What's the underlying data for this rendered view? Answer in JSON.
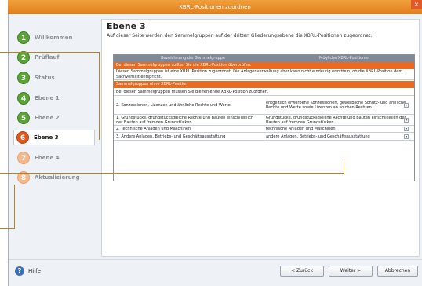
{
  "window": {
    "title": "XBRL-Positionen zuordnen",
    "close_label": "×"
  },
  "sidebar": {
    "items": [
      {
        "num": "1",
        "label": "Willkommen",
        "state": "done"
      },
      {
        "num": "2",
        "label": "Prüflauf",
        "state": "done"
      },
      {
        "num": "3",
        "label": "Status",
        "state": "done"
      },
      {
        "num": "4",
        "label": "Ebene 1",
        "state": "done"
      },
      {
        "num": "5",
        "label": "Ebene 2",
        "state": "done"
      },
      {
        "num": "6",
        "label": "Ebene 3",
        "state": "active"
      },
      {
        "num": "7",
        "label": "Ebene 4",
        "state": "pending"
      },
      {
        "num": "8",
        "label": "Aktualisierung",
        "state": "pending"
      }
    ]
  },
  "main": {
    "title": "Ebene 3",
    "description": "Auf dieser Seite werden den Sammelgruppen auf der dritten Gliederungsebene die XBRL-Positionen zugeordnet."
  },
  "grid": {
    "columns": [
      "Bezeichnung der Sammelgruppe",
      "Mögliche XBRL-Positionen"
    ],
    "section1_header": "Bei diesen Sammelgruppen sollten Sie die XBRL-Position überprüfen.",
    "section1_info": "Diesen Sammelgruppen ist eine XBRL-Position zugeordnet. Die Anlagenverwaltung aber kann nicht eindeutig ermitteln, ob die XBRL-Position dem Sachverhalt entspricht.",
    "section2_header": "Sammelgruppen ohne XBRL-Position",
    "section2_info": "Bei diesen Sammelgruppen müssen Sie die fehlende XBRL-Position zuordnen.",
    "rows": [
      {
        "group": "2. Konzessionen, Lizenzen und ähnliche Rechte und Werte",
        "position": "entgeltlich erworbene Konzessionen, gewerbliche Schutz- und ähnliche Rechte und Werte sowie Lizenzen an solchen Rechten ..."
      },
      {
        "group": "1. Grundstücke, grundstücksgleiche Rechte und Bauten einschließlich der Bauten auf fremden Grundstücken",
        "position": "Grundstücke, grundstücksgleiche Rechte und Bauten einschließlich der Bauten auf fremden Grundstücken"
      },
      {
        "group": "2. Technische Anlagen und Maschinen",
        "position": "technische Anlagen und Maschinen"
      },
      {
        "group": "3. Andere Anlagen, Betriebs- und Geschäftsausstattung",
        "position": "andere Anlagen, Betriebs- und Geschäftsausstattung"
      }
    ]
  },
  "footer": {
    "help_label": "Hilfe",
    "back_label": "< Zurück",
    "next_label": "Weiter >",
    "cancel_label": "Abbrechen"
  }
}
